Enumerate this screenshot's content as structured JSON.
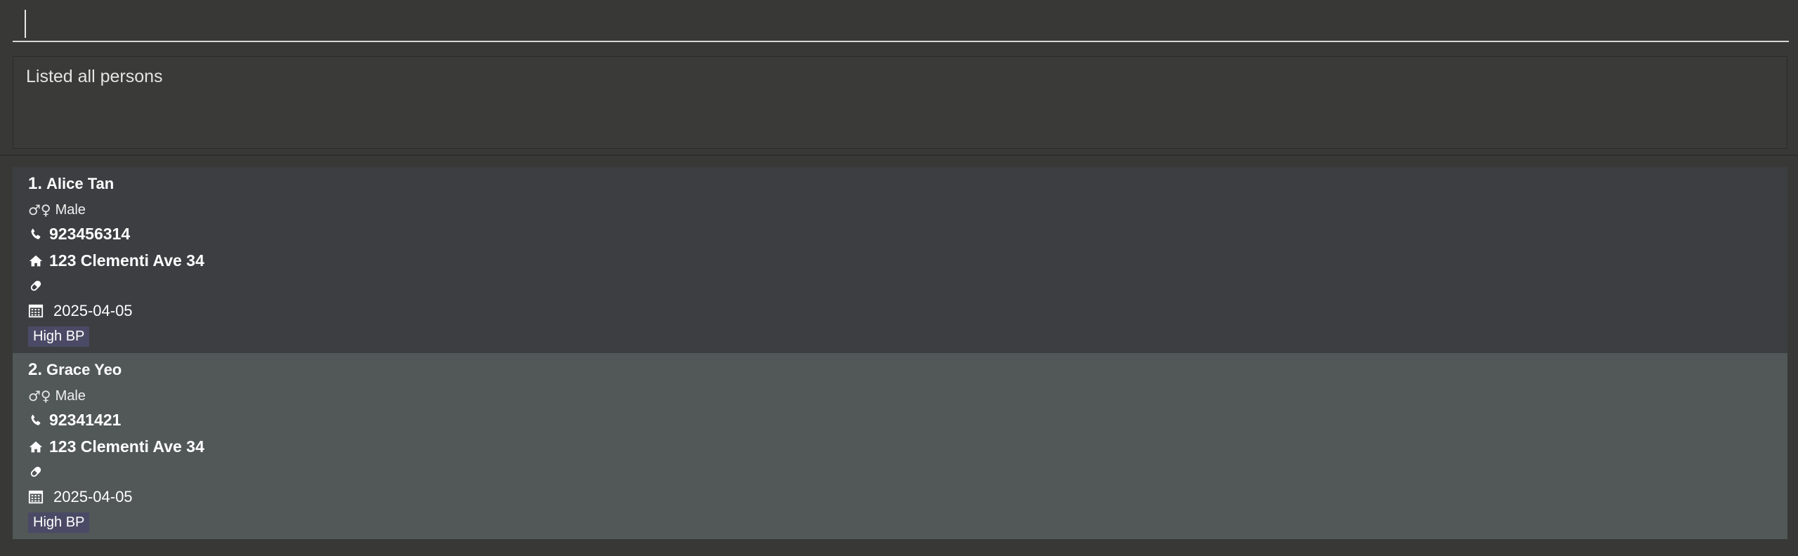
{
  "command": {
    "value": "",
    "placeholder": ""
  },
  "result": {
    "message": "Listed all persons"
  },
  "persons": [
    {
      "index": "1.",
      "name": "Alice Tan",
      "gender_symbol": "♂♀",
      "gender": "Male",
      "phone": "923456314",
      "address": "123 Clementi Ave 34",
      "medication": "",
      "date": "2025-04-05",
      "tags": [
        "High BP"
      ]
    },
    {
      "index": "2.",
      "name": "Grace Yeo",
      "gender_symbol": "♂♀",
      "gender": "Male",
      "phone": "92341421",
      "address": "123 Clementi Ave 34",
      "medication": "",
      "date": "2025-04-05",
      "tags": [
        "High BP"
      ]
    }
  ],
  "colors": {
    "background": "#383836",
    "card_default": "#3c3e41",
    "card_selected": "#515857",
    "tag": "#4a4a66",
    "text": "#ffffff"
  },
  "icons": {
    "gender": "gender-icon",
    "phone": "phone-icon",
    "address": "home-icon",
    "medication": "pill-icon",
    "date": "calendar-icon"
  }
}
